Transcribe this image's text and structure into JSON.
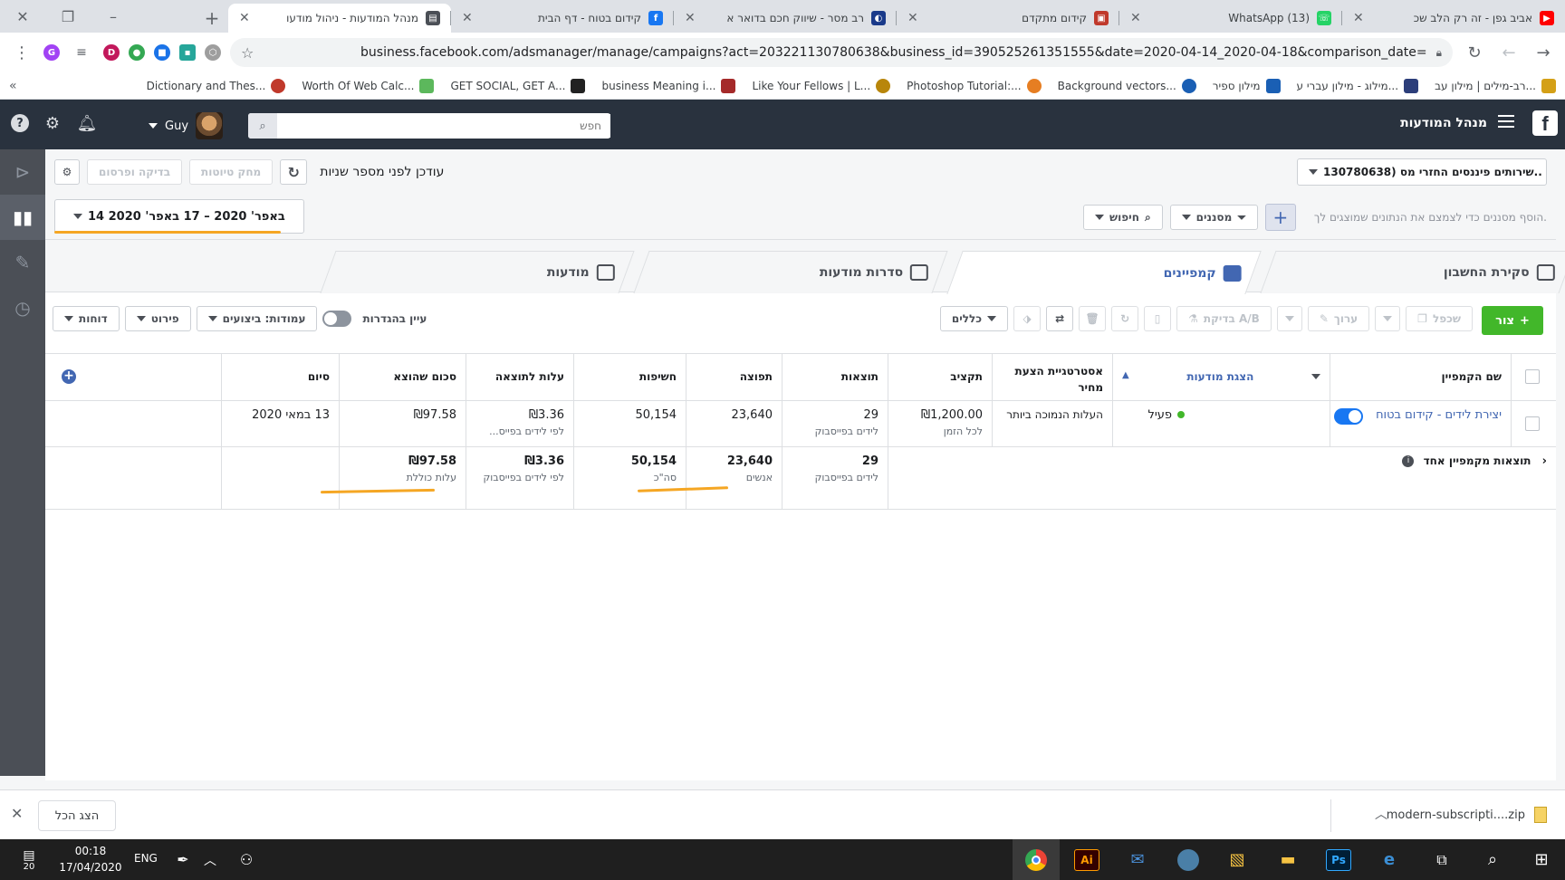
{
  "browser": {
    "tabs": [
      {
        "title": "אביב גפן - זה רק הלב שכ",
        "favicon_color": "#ff0000"
      },
      {
        "title": "(13) WhatsApp",
        "favicon_color": "#25d366"
      },
      {
        "title": "קידום מתקדם",
        "favicon_color": "#c0392b"
      },
      {
        "title": "רב מסר - שיווק חכם בדואר א",
        "favicon_color": "#1a3a8a"
      },
      {
        "title": "קידום בטוח - דף הבית",
        "favicon_color": "#1877f2"
      },
      {
        "title": "מנהל המודעות - ניהול מודעו",
        "favicon_color": "#4b4f56"
      }
    ],
    "url": "business.facebook.com/adsmanager/manage/campaigns?act=203221130780638&business_id=390525261351555&date=2020-04-14_2020-04-18&comparison_date=",
    "bookmarks": [
      {
        "label": "רב-מילים | מילון עב...",
        "color": "#d4a017"
      },
      {
        "label": "מילוג - מילון עברי ע...",
        "color": "#2c3e7a"
      },
      {
        "label": "מילון ספיר",
        "color": "#1a5fb4"
      },
      {
        "label": "Background vectors...",
        "color": "#1a5fb4"
      },
      {
        "label": "Photoshop Tutorial:...",
        "color": "#e67e22"
      },
      {
        "label": "Like Your Fellows | L...",
        "color": "#b8860b"
      },
      {
        "label": "business Meaning i...",
        "color": "#a52a2a"
      },
      {
        "label": "GET SOCIAL, GET A...",
        "color": "#222222"
      },
      {
        "label": "Worth Of Web Calc...",
        "color": "#5cb85c"
      },
      {
        "label": "Dictionary and Thes...",
        "color": "#c0392b"
      }
    ],
    "bookmarks_more": "«"
  },
  "fb": {
    "app_title": "מנהל המודעות",
    "search_placeholder": "חפש",
    "user_name": "Guy",
    "account": "שירותים פיננסים החזרי מס (130780638..",
    "sync_text": "עודכן לפני מספר שניות",
    "discard_label": "מחק טיוטות",
    "review_label": "בדיקה ופרסום",
    "date_range": "14 באפר' 2020 – 17 באפר' 2020",
    "search_btn": "חיפוש",
    "filters_btn": "מסננים",
    "filter_hint": "הוסף מסננים כדי לצמצם את הנתונים שמוצגים לך.",
    "tabs": {
      "account": "סקירת החשבון",
      "campaigns": "קמפיינים",
      "adsets": "סדרות מודעות",
      "ads": "מודעות"
    },
    "actions": {
      "create": "צור",
      "duplicate": "שכפל",
      "edit": "ערוך",
      "ab_test": "בדיקת A/B",
      "rules": "כללים",
      "view_setup": "עיין בהגדרות",
      "columns": "עמודות: ביצועים",
      "breakdown": "פירוט",
      "reports": "דוחות"
    },
    "table": {
      "headers": {
        "name": "שם הקמפיין",
        "delivery": "הצגת מודעות",
        "bid": "אסטרטגיית הצעת מחיר",
        "budget": "תקציב",
        "results": "תוצאות",
        "reach": "תפוצה",
        "impressions": "חשיפות",
        "cost": "עלות לתוצאה",
        "spent": "סכום שהוצא",
        "ends": "סיום"
      },
      "row": {
        "name": "יצירת לידים - קידום בטוח",
        "delivery": "פעיל",
        "bid": "העלות הנמוכה ביותר",
        "budget": "₪1,200.00",
        "budget_sub": "לכל הזמן",
        "results": "29",
        "results_sub": "לידים בפייסבוק",
        "reach": "23,640",
        "impressions": "50,154",
        "cost": "₪3.36",
        "cost_sub": "לפי לידים בפייס...",
        "spent": "₪97.58",
        "ends": "13 במאי 2020"
      },
      "summary": {
        "label": "תוצאות מקמפיין אחד",
        "results": "29",
        "results_sub": "לידים בפייסבוק",
        "reach": "23,640",
        "reach_sub": "אנשים",
        "impressions": "50,154",
        "impressions_sub": "סה\"כ",
        "cost": "₪3.36",
        "cost_sub": "לפי לידים בפייסבוק",
        "spent": "₪97.58",
        "spent_sub": "עלות כוללת"
      }
    }
  },
  "downloads": {
    "file": "modern-subscripti....zip",
    "show_all": "הצג הכל"
  },
  "taskbar": {
    "time": "00:18",
    "date": "17/04/2020",
    "lang": "ENG",
    "notif_count": "20",
    "apps": [
      {
        "label": "Ai",
        "bg": "#330000",
        "fg": "#ff9a00"
      },
      {
        "label": "Ps",
        "bg": "#001e36",
        "fg": "#31a8ff"
      }
    ]
  },
  "colors": {
    "accent": "#4267b2",
    "create_green": "#42b72a",
    "annotation": "#f5a623"
  }
}
